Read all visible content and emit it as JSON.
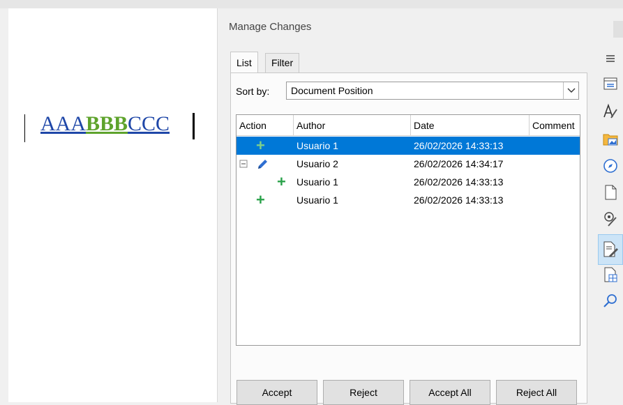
{
  "document": {
    "text_segments": [
      {
        "text": "AAA",
        "style": "inserted-blue"
      },
      {
        "text": "BBB",
        "style": "inserted-green-bold"
      },
      {
        "text": "CCC",
        "style": "inserted-blue"
      }
    ]
  },
  "panel": {
    "title": "Manage Changes",
    "tabs": [
      {
        "label": "List",
        "active": true
      },
      {
        "label": "Filter",
        "active": false
      }
    ],
    "sort_label": "Sort by:",
    "sort_value": "Document Position",
    "columns": [
      "Action",
      "Author",
      "Date",
      "Comment"
    ],
    "rows": [
      {
        "action_icon": "plus-icon",
        "author": "Usuario 1",
        "date": "26/02/2026 14:33:13",
        "comment": "",
        "selected": true,
        "indent": 0
      },
      {
        "action_icon": "pencil-icon",
        "author": "Usuario 2",
        "date": "26/02/2026 14:34:17",
        "comment": "",
        "selected": false,
        "expandable": true,
        "indent": 0
      },
      {
        "action_icon": "plus-icon",
        "author": "Usuario 1",
        "date": "26/02/2026 14:33:13",
        "comment": "",
        "selected": false,
        "indent": 1
      },
      {
        "action_icon": "plus-icon",
        "author": "Usuario 1",
        "date": "26/02/2026 14:33:13",
        "comment": "",
        "selected": false,
        "indent": 0
      }
    ],
    "buttons": {
      "accept": "Accept",
      "reject": "Reject",
      "accept_all": "Accept All",
      "reject_all": "Reject All"
    }
  },
  "sidebar": {
    "icons": [
      "menu-icon",
      "properties-icon",
      "styles-icon",
      "gallery-icon",
      "navigator-icon",
      "page-icon",
      "style-inspector-icon",
      "manage-changes-icon",
      "design-icon",
      "find-icon"
    ]
  },
  "colors": {
    "selection": "#0078d7",
    "insert_blue": "#1f47a8",
    "insert_green": "#5ea32c",
    "plus": "#2aa24a"
  }
}
